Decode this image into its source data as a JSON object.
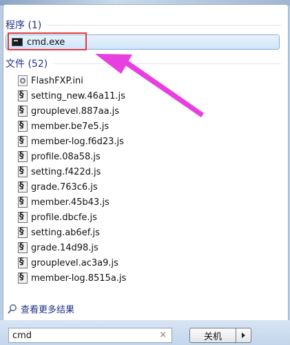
{
  "programs": {
    "header": "程序 (1)",
    "items": [
      {
        "label": "cmd.exe",
        "icon": "cmd-icon",
        "selected": true
      }
    ]
  },
  "files": {
    "header": "文件 (52)",
    "items": [
      {
        "label": "FlashFXP.ini",
        "icon": "ini-file-icon"
      },
      {
        "label": "setting_new.46a11.js",
        "icon": "js-file-icon"
      },
      {
        "label": "grouplevel.887aa.js",
        "icon": "js-file-icon"
      },
      {
        "label": "member.be7e5.js",
        "icon": "js-file-icon"
      },
      {
        "label": "member-log.f6d23.js",
        "icon": "js-file-icon"
      },
      {
        "label": "profile.08a58.js",
        "icon": "js-file-icon"
      },
      {
        "label": "setting.f422d.js",
        "icon": "js-file-icon"
      },
      {
        "label": "grade.763c6.js",
        "icon": "js-file-icon"
      },
      {
        "label": "member.45b43.js",
        "icon": "js-file-icon"
      },
      {
        "label": "profile.dbcfe.js",
        "icon": "js-file-icon"
      },
      {
        "label": "setting.ab6ef.js",
        "icon": "js-file-icon"
      },
      {
        "label": "grade.14d98.js",
        "icon": "js-file-icon"
      },
      {
        "label": "grouplevel.ac3a9.js",
        "icon": "js-file-icon"
      },
      {
        "label": "member-log.8515a.js",
        "icon": "js-file-icon"
      }
    ]
  },
  "more_results": {
    "label": "查看更多结果",
    "icon": "search-icon"
  },
  "search": {
    "value": "cmd",
    "clear_glyph": "×"
  },
  "shutdown": {
    "label": "关机"
  },
  "annotation": {
    "highlight_color": "#e03a3e",
    "arrow_color": "#e83fe0"
  }
}
